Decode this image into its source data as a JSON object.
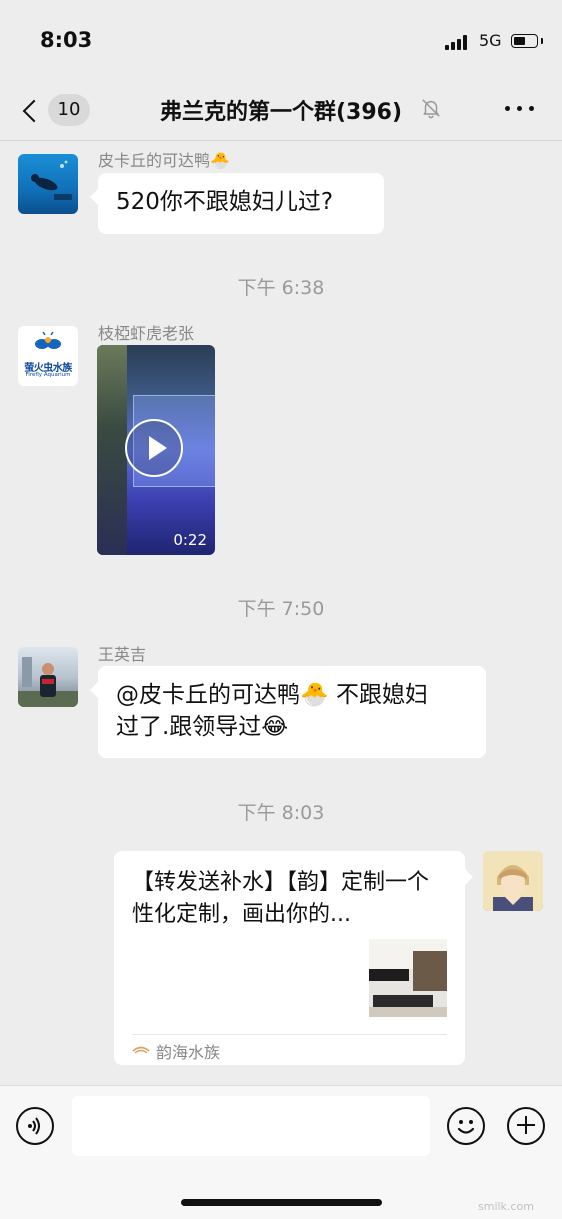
{
  "status_bar": {
    "time": "8:03",
    "network": "5G",
    "battery_level": 0.55
  },
  "nav": {
    "unread_count": "10",
    "title": "弗兰克的第一个群(396)"
  },
  "messages": [
    {
      "sender": "皮卡丘的可达鸭🐣",
      "text": "520你不跟媳妇儿过?"
    },
    {
      "timestamp": "下午 6:38"
    },
    {
      "sender": "枝椏虾虎老张",
      "video_duration": "0:22",
      "avatar_logo_text": "萤火虫水族",
      "avatar_logo_subtext": "Firefly Aquarium"
    },
    {
      "timestamp": "下午 7:50"
    },
    {
      "sender": "王英吉",
      "text_line1": "@皮卡丘的可达鸭🐣 不跟媳妇",
      "text_line2": "过了.跟领导过😂"
    },
    {
      "timestamp": "下午 8:03"
    },
    {
      "link_title": "【转发送补水】【韵】定制一个性化定制，画出你的...",
      "link_source": "韵海水族"
    }
  ],
  "watermark": "smilk.com",
  "icons": [
    "back-chevron-icon",
    "bell-off-icon",
    "more-icon",
    "play-icon",
    "voice-icon",
    "emoji-icon",
    "plus-icon"
  ],
  "colors": {
    "background": "#ededed",
    "bubble": "#ffffff",
    "meta_text": "#9a9a9a"
  }
}
